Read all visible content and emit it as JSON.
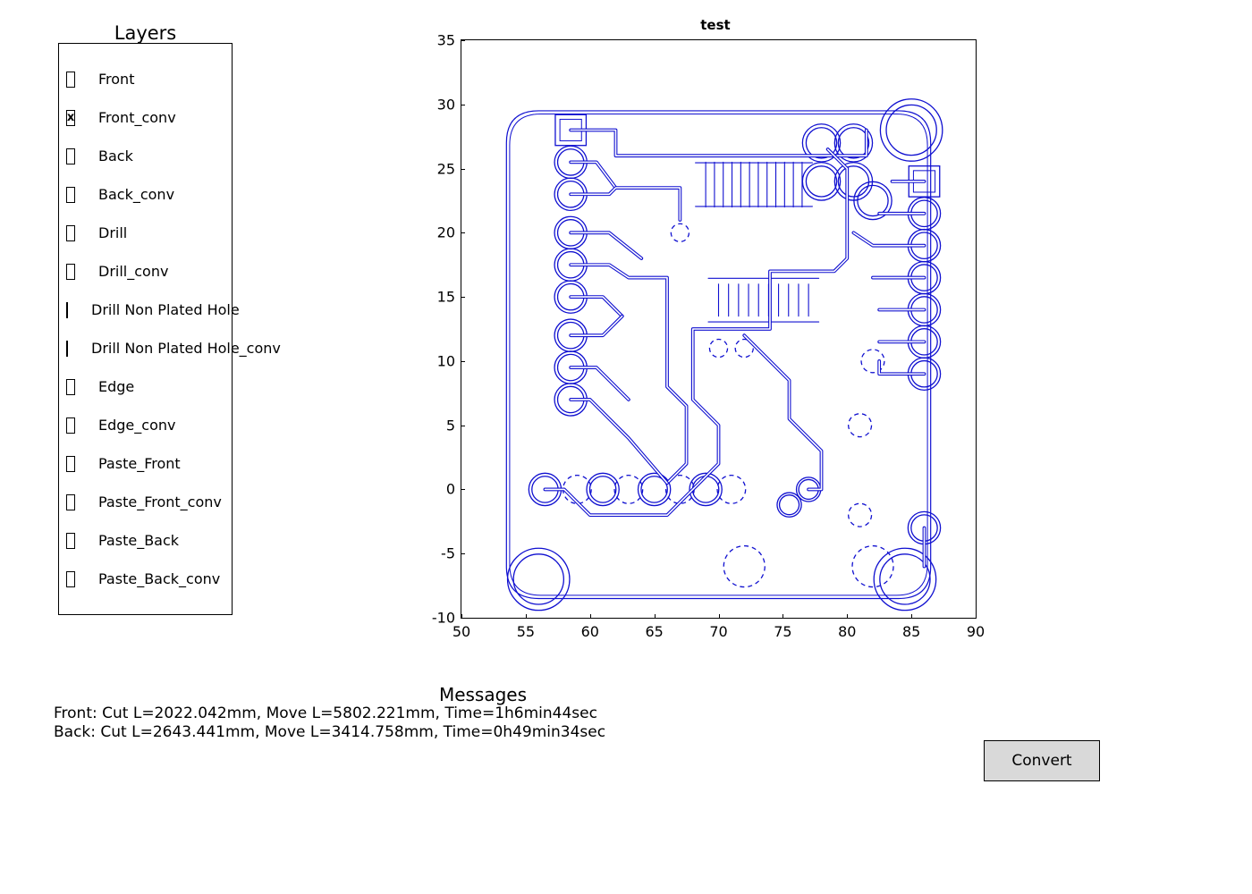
{
  "layers_panel": {
    "title": "Layers",
    "items": [
      {
        "label": "Front",
        "checked": false
      },
      {
        "label": "Front_conv",
        "checked": true
      },
      {
        "label": "Back",
        "checked": false
      },
      {
        "label": "Back_conv",
        "checked": false
      },
      {
        "label": "Drill",
        "checked": false
      },
      {
        "label": "Drill_conv",
        "checked": false
      },
      {
        "label": "Drill Non Plated Hole",
        "checked": false
      },
      {
        "label": "Drill Non Plated Hole_conv",
        "checked": false
      },
      {
        "label": "Edge",
        "checked": false
      },
      {
        "label": "Edge_conv",
        "checked": false
      },
      {
        "label": "Paste_Front",
        "checked": false
      },
      {
        "label": "Paste_Front_conv",
        "checked": false
      },
      {
        "label": "Paste_Back",
        "checked": false
      },
      {
        "label": "Paste_Back_conv",
        "checked": false
      }
    ]
  },
  "plot": {
    "title": "test",
    "x_ticks": [
      "50",
      "55",
      "60",
      "65",
      "70",
      "75",
      "80",
      "85",
      "90"
    ],
    "y_ticks": [
      "-10",
      "-5",
      "0",
      "5",
      "10",
      "15",
      "20",
      "25",
      "30",
      "35"
    ],
    "x_range": [
      50,
      90
    ],
    "y_range": [
      -10,
      35
    ],
    "trace_color": "#1010d0"
  },
  "messages": {
    "title": "Messages",
    "lines": [
      "Front: Cut L=2022.042mm, Move L=5802.221mm, Time=1h6min44sec",
      "Back: Cut L=2643.441mm, Move L=3414.758mm, Time=0h49min34sec"
    ]
  },
  "buttons": {
    "convert": "Convert"
  },
  "chart_data": {
    "type": "line",
    "title": "test",
    "xlabel": "",
    "ylabel": "",
    "xlim": [
      50,
      90
    ],
    "ylim": [
      -10,
      35
    ],
    "description": "PCB routing toolpath outline (Front_conv layer): traces, pads and board outline drawn as blue vector paths and circles.",
    "board_outline": {
      "x": [
        53.5,
        86.5
      ],
      "y": [
        -8.5,
        29.5
      ],
      "corner_radius": 2.5
    },
    "mounting_holes": [
      {
        "cx": 56,
        "cy": -7,
        "r": 2.3
      },
      {
        "cx": 84.5,
        "cy": -7,
        "r": 2.3
      },
      {
        "cx": 85,
        "cy": 28,
        "r": 2.3
      }
    ],
    "drill_pads_dashed": [
      {
        "cx": 59,
        "cy": 0,
        "r": 1.1
      },
      {
        "cx": 63,
        "cy": 0,
        "r": 1.1
      },
      {
        "cx": 67,
        "cy": 0,
        "r": 1.1
      },
      {
        "cx": 71,
        "cy": 0,
        "r": 1.1
      },
      {
        "cx": 72,
        "cy": -6,
        "r": 1.6
      },
      {
        "cx": 82,
        "cy": -6,
        "r": 1.6
      },
      {
        "cx": 81,
        "cy": 5,
        "r": 0.9
      },
      {
        "cx": 81,
        "cy": -2,
        "r": 0.9
      },
      {
        "cx": 67,
        "cy": 20,
        "r": 0.7
      },
      {
        "cx": 70,
        "cy": 11,
        "r": 0.7
      },
      {
        "cx": 72,
        "cy": 11,
        "r": 0.7
      },
      {
        "cx": 82,
        "cy": 10,
        "r": 0.9
      }
    ],
    "left_header_pads": [
      {
        "cx": 58.5,
        "cy": 28,
        "r": 1.2,
        "shape": "square"
      },
      {
        "cx": 58.5,
        "cy": 25.5,
        "r": 1.2,
        "shape": "round"
      },
      {
        "cx": 58.5,
        "cy": 23,
        "r": 1.2,
        "shape": "round"
      },
      {
        "cx": 58.5,
        "cy": 20,
        "r": 1.2,
        "shape": "round"
      },
      {
        "cx": 58.5,
        "cy": 17.5,
        "r": 1.2,
        "shape": "round"
      },
      {
        "cx": 58.5,
        "cy": 15,
        "r": 1.2,
        "shape": "round"
      },
      {
        "cx": 58.5,
        "cy": 12,
        "r": 1.2,
        "shape": "round"
      },
      {
        "cx": 58.5,
        "cy": 9.5,
        "r": 1.2,
        "shape": "round"
      },
      {
        "cx": 58.5,
        "cy": 7,
        "r": 1.2,
        "shape": "round"
      }
    ],
    "right_header_pads": [
      {
        "cx": 86,
        "cy": 24,
        "r": 1.2,
        "shape": "square"
      },
      {
        "cx": 86,
        "cy": 21.5,
        "r": 1.2,
        "shape": "round"
      },
      {
        "cx": 86,
        "cy": 19,
        "r": 1.2,
        "shape": "round"
      },
      {
        "cx": 86,
        "cy": 16.5,
        "r": 1.2,
        "shape": "round"
      },
      {
        "cx": 86,
        "cy": 14,
        "r": 1.2,
        "shape": "round"
      },
      {
        "cx": 86,
        "cy": 11.5,
        "r": 1.2,
        "shape": "round"
      },
      {
        "cx": 86,
        "cy": 9,
        "r": 1.2,
        "shape": "round"
      },
      {
        "cx": 86,
        "cy": -3,
        "r": 1.2,
        "shape": "round"
      }
    ],
    "top_connector_pads": [
      {
        "cx": 78,
        "cy": 27,
        "r": 1.4
      },
      {
        "cx": 80.5,
        "cy": 27,
        "r": 1.4
      },
      {
        "cx": 78,
        "cy": 24,
        "r": 1.4
      },
      {
        "cx": 80.5,
        "cy": 24,
        "r": 1.4
      },
      {
        "cx": 82,
        "cy": 22.5,
        "r": 1.4
      }
    ],
    "bottom_row_pads": [
      {
        "cx": 56.5,
        "cy": 0,
        "r": 1.2
      },
      {
        "cx": 61,
        "cy": 0,
        "r": 1.2
      },
      {
        "cx": 65,
        "cy": 0,
        "r": 1.2
      },
      {
        "cx": 69,
        "cy": 0,
        "r": 1.2
      },
      {
        "cx": 75.5,
        "cy": -1.2,
        "r": 0.9
      },
      {
        "cx": 77,
        "cy": 0,
        "r": 0.9
      }
    ],
    "ic_pin_combs": [
      {
        "x_start": 69,
        "x_end": 76.5,
        "y_top": 25.5,
        "y_bot": 22,
        "pins": 12
      },
      {
        "x_start": 70,
        "x_end": 77,
        "y_top": 16,
        "y_bot": 13.5,
        "pins": 10
      }
    ],
    "sample_traces": [
      {
        "points": [
          [
            58.5,
            28
          ],
          [
            62,
            28
          ],
          [
            62,
            26
          ],
          [
            75,
            26
          ],
          [
            81.5,
            26
          ],
          [
            81.5,
            28
          ]
        ]
      },
      {
        "points": [
          [
            58.5,
            25.5
          ],
          [
            60.5,
            25.5
          ],
          [
            62,
            23.5
          ]
        ]
      },
      {
        "points": [
          [
            58.5,
            23
          ],
          [
            61.5,
            23
          ],
          [
            62,
            23.5
          ],
          [
            67,
            23.5
          ],
          [
            67,
            21
          ]
        ]
      },
      {
        "points": [
          [
            58.5,
            20
          ],
          [
            61.5,
            20
          ],
          [
            64,
            18
          ]
        ]
      },
      {
        "points": [
          [
            58.5,
            17.5
          ],
          [
            61.5,
            17.5
          ],
          [
            63,
            16.5
          ],
          [
            66,
            16.5
          ],
          [
            66,
            14
          ],
          [
            66,
            8
          ],
          [
            67.5,
            6.5
          ],
          [
            67.5,
            2
          ],
          [
            66,
            0.5
          ]
        ]
      },
      {
        "points": [
          [
            58.5,
            15
          ],
          [
            61,
            15
          ],
          [
            62.5,
            13.5
          ]
        ]
      },
      {
        "points": [
          [
            58.5,
            12
          ],
          [
            61,
            12
          ],
          [
            62.5,
            13.5
          ]
        ]
      },
      {
        "points": [
          [
            58.5,
            9.5
          ],
          [
            60.5,
            9.5
          ],
          [
            63,
            7
          ]
        ]
      },
      {
        "points": [
          [
            58.5,
            7
          ],
          [
            60,
            7
          ],
          [
            63,
            4
          ],
          [
            66,
            0.5
          ]
        ]
      },
      {
        "points": [
          [
            56.5,
            0
          ],
          [
            58,
            0
          ],
          [
            60,
            -2
          ],
          [
            66,
            -2
          ],
          [
            70,
            2
          ],
          [
            70,
            5
          ],
          [
            68,
            7
          ],
          [
            68,
            12.5
          ],
          [
            74,
            12.5
          ],
          [
            74,
            17
          ],
          [
            79,
            17
          ],
          [
            80,
            18
          ],
          [
            80,
            25
          ],
          [
            78.5,
            26.5
          ]
        ]
      },
      {
        "points": [
          [
            86,
            24
          ],
          [
            83.5,
            24
          ]
        ]
      },
      {
        "points": [
          [
            86,
            21.5
          ],
          [
            82.5,
            21.5
          ]
        ]
      },
      {
        "points": [
          [
            86,
            19
          ],
          [
            82,
            19
          ],
          [
            80.5,
            20
          ]
        ]
      },
      {
        "points": [
          [
            86,
            16.5
          ],
          [
            82,
            16.5
          ]
        ]
      },
      {
        "points": [
          [
            86,
            14
          ],
          [
            82.5,
            14
          ]
        ]
      },
      {
        "points": [
          [
            86,
            11.5
          ],
          [
            82.5,
            11.5
          ]
        ]
      },
      {
        "points": [
          [
            86,
            9
          ],
          [
            82.5,
            9
          ],
          [
            82.5,
            10
          ]
        ]
      },
      {
        "points": [
          [
            86,
            -3
          ],
          [
            86,
            -6
          ]
        ]
      },
      {
        "points": [
          [
            77,
            0
          ],
          [
            78,
            0
          ],
          [
            78,
            3
          ],
          [
            75.5,
            5.5
          ],
          [
            75.5,
            8.5
          ],
          [
            72,
            12
          ]
        ]
      }
    ]
  }
}
